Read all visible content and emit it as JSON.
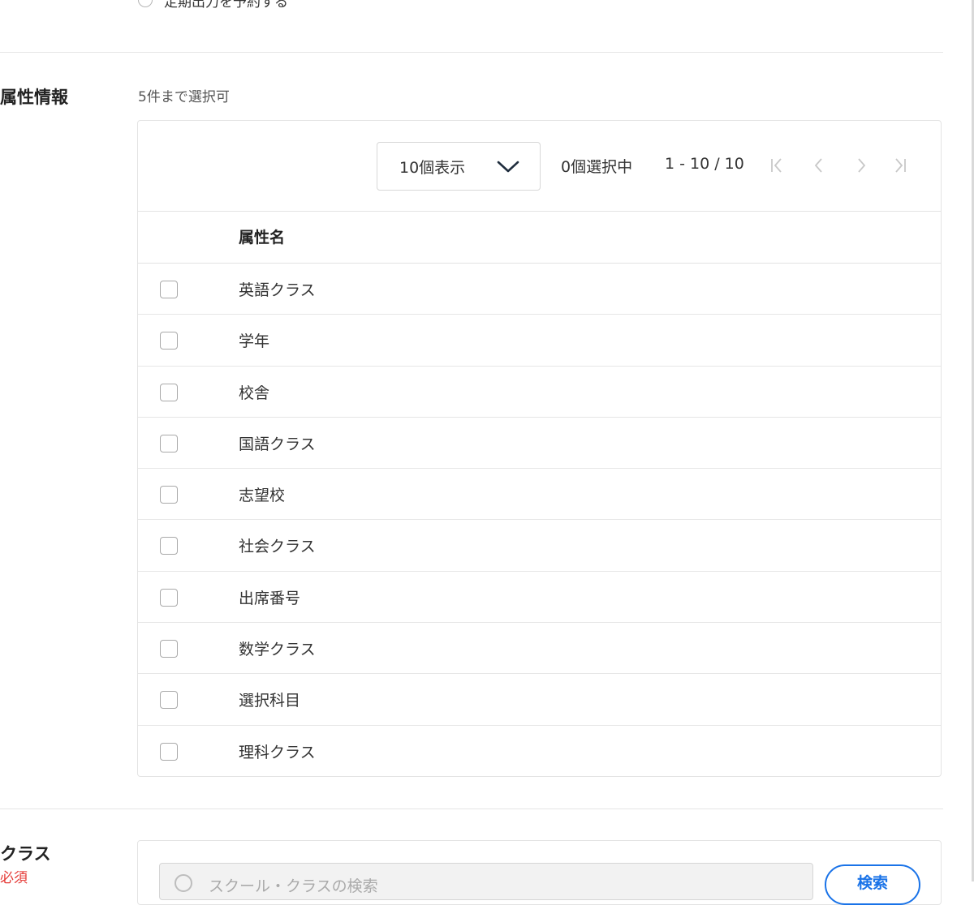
{
  "schedule_option": {
    "label": "定期出力を予約する"
  },
  "attributes": {
    "label": "属性情報",
    "hint": "5件まで選択可",
    "page_size_select": "10個表示",
    "selected_count": "0個選択中",
    "range": "1 - 10 / 10",
    "column_header": "属性名",
    "rows": [
      {
        "name": "英語クラス",
        "checked": false
      },
      {
        "name": "学年",
        "checked": false
      },
      {
        "name": "校舎",
        "checked": false
      },
      {
        "name": "国語クラス",
        "checked": false
      },
      {
        "name": "志望校",
        "checked": false
      },
      {
        "name": "社会クラス",
        "checked": false
      },
      {
        "name": "出席番号",
        "checked": false
      },
      {
        "name": "数学クラス",
        "checked": false
      },
      {
        "name": "選択科目",
        "checked": false
      },
      {
        "name": "理科クラス",
        "checked": false
      }
    ]
  },
  "class_section": {
    "label": "クラス",
    "required": "必須",
    "search_placeholder": "スクール・クラスの検索",
    "search_button": "検索"
  },
  "colors": {
    "accent": "#1a73e8",
    "required": "#e53935"
  },
  "icons": [
    "chevron-down-icon",
    "first-page-icon",
    "prev-page-icon",
    "next-page-icon",
    "last-page-icon",
    "search-icon"
  ]
}
